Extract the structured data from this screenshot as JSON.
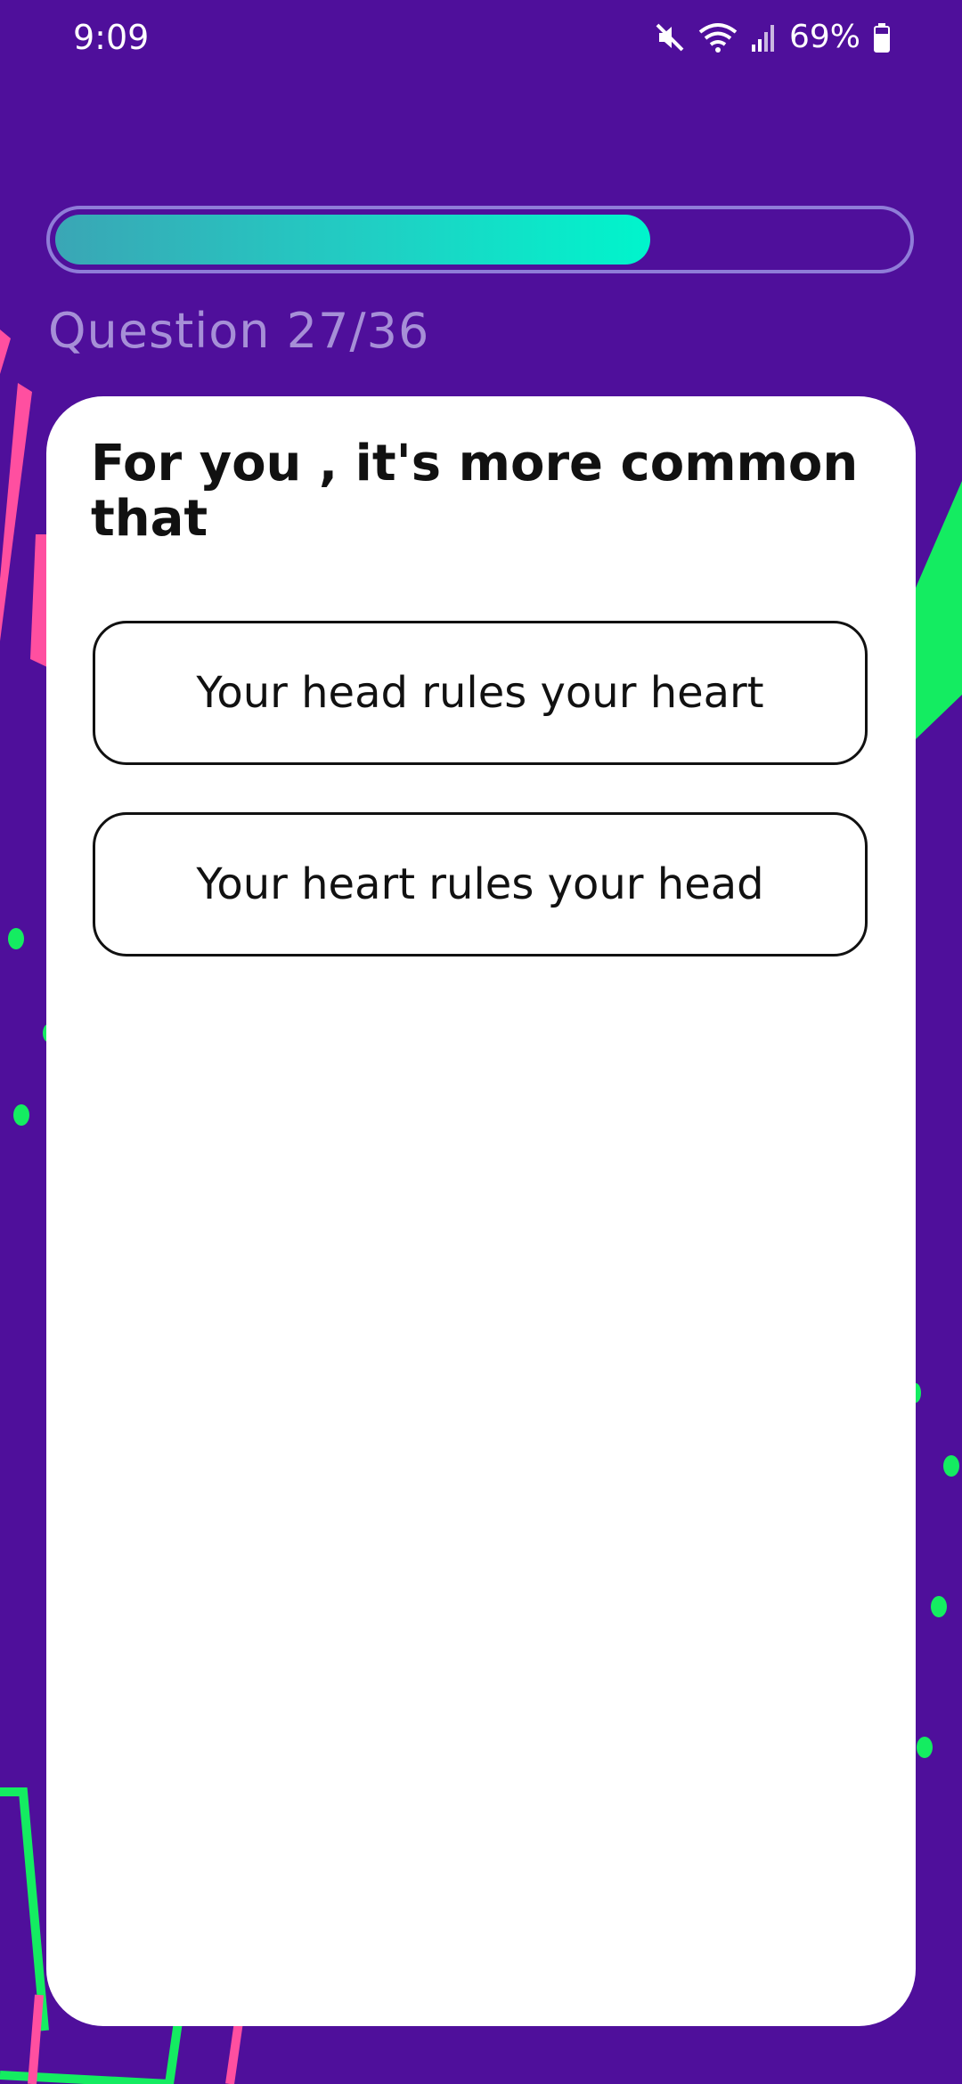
{
  "status_bar": {
    "time": "9:09",
    "battery": "69%",
    "icons": [
      "mute-icon",
      "wifi-icon",
      "signal-icon",
      "battery-icon"
    ]
  },
  "quiz": {
    "progress": 0.7,
    "question_counter": "Question 27/36",
    "question": "For you , it's more common that",
    "answers": [
      "Your head rules your heart",
      "Your heart rules your head"
    ]
  },
  "colors": {
    "background": "#4f0f9b",
    "progress_start": "#3aa6b5",
    "progress_end": "#00f5cc",
    "card": "#ffffff",
    "accent_pink": "#ff4fa0",
    "accent_green": "#14ec61"
  }
}
